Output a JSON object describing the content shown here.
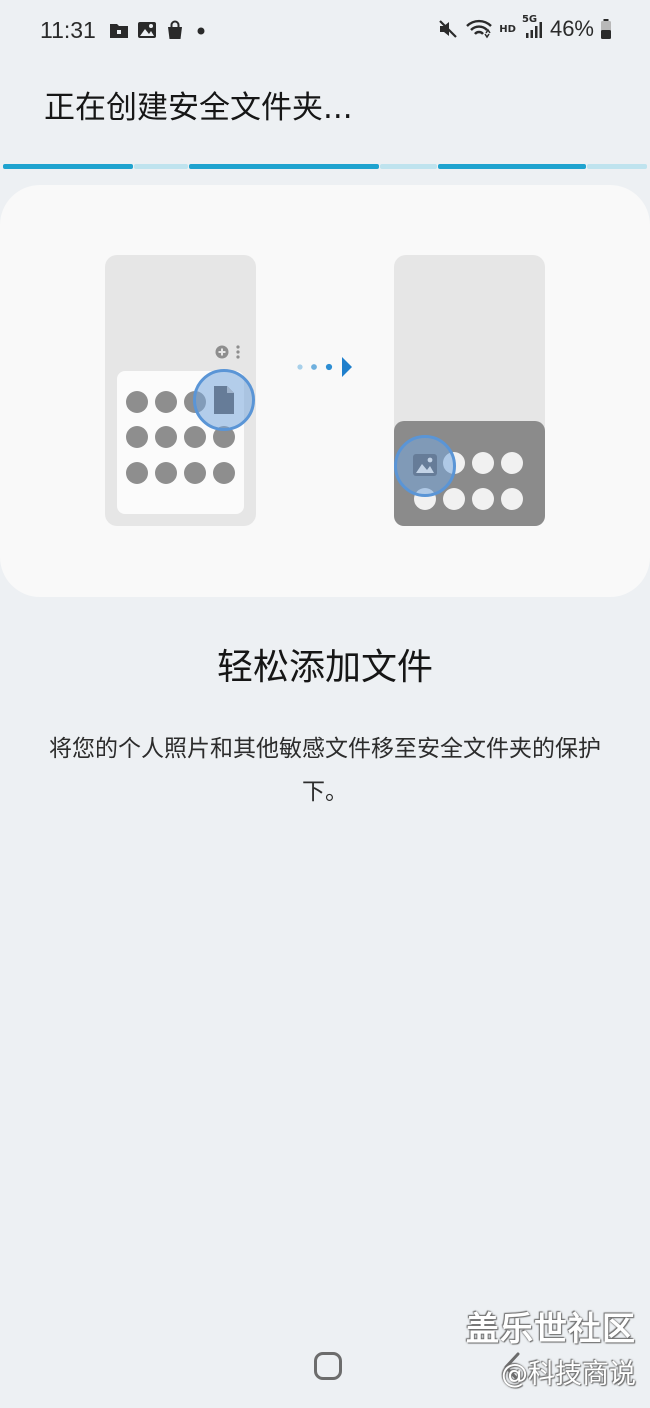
{
  "status_bar": {
    "time": "11:31",
    "network": "HD",
    "network_gen": "5G",
    "battery": "46%",
    "left_icons": [
      "folder-lock-icon",
      "image-icon",
      "shopping-bag-icon",
      "dot-icon"
    ],
    "right_icons": [
      "mute-icon",
      "wifi-icon",
      "signal-icon",
      "battery-icon"
    ]
  },
  "header": {
    "title": "正在创建安全文件夹..."
  },
  "progress": {
    "segments": 3,
    "accent": "#1fa3cf",
    "track": "#bfe3ee"
  },
  "illustration": {
    "file_icon": "file-icon",
    "image_icon": "image-icon",
    "arrow_icon": "arrow-right-icon"
  },
  "content": {
    "heading": "轻松添加文件",
    "description": "将您的个人照片和其他敏感文件移至安全文件夹的保护下。"
  },
  "nav_bar": {
    "home": "home-icon",
    "back": "back-icon"
  },
  "watermark": {
    "line1": "盖乐世社区",
    "line2": "@科技商说"
  },
  "colors": {
    "background": "#edf0f3",
    "card": "#f9f9f9",
    "highlight_ring": "#5a95d6"
  }
}
